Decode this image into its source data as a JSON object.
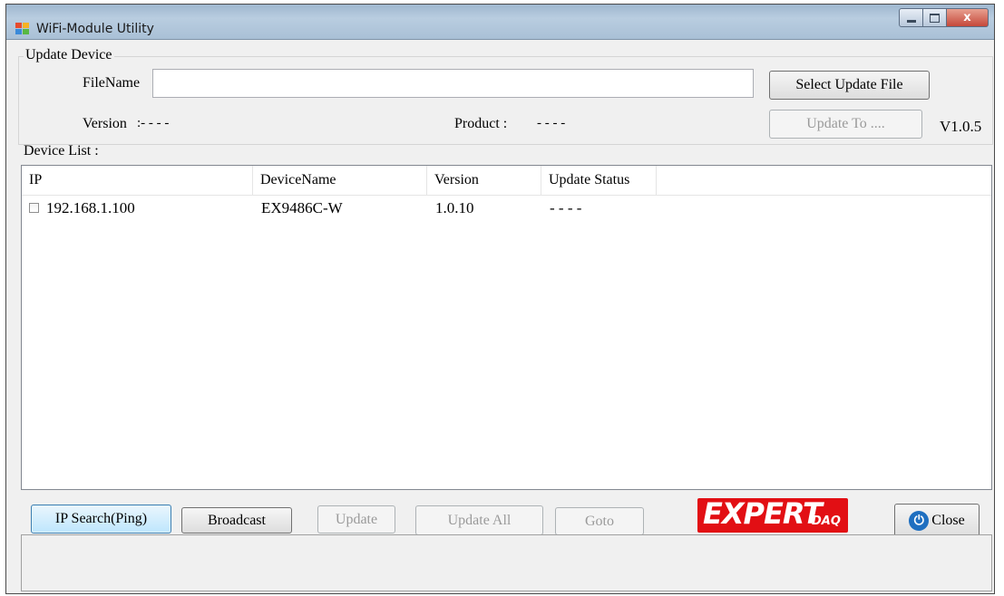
{
  "window": {
    "title": "WiFi-Module Utility",
    "close_glyph": "x"
  },
  "update_device": {
    "group_label": "Update Device",
    "filename_label": "FileName",
    "filename_value": "",
    "select_file_button": "Select Update File",
    "version_label": "Version",
    "version_value": ":- - - -",
    "product_label": "Product :",
    "product_value": "- - - -",
    "update_to_button": "Update To ....",
    "app_version": "V1.0.5"
  },
  "device_list": {
    "label": "Device List :",
    "columns": [
      "IP",
      "DeviceName",
      "Version",
      "Update Status"
    ],
    "rows": [
      {
        "ip": "192.168.1.100",
        "device_name": "EX9486C-W",
        "version": "1.0.10",
        "update_status": "- - - -",
        "checked": false
      }
    ]
  },
  "buttons": {
    "ip_search": "IP Search(Ping)",
    "broadcast": "Broadcast",
    "update": "Update",
    "update_all": "Update All",
    "goto": "Goto",
    "close": "Close"
  },
  "logo": {
    "main": "EXPERT",
    "sub": "DAQ"
  },
  "status_bar": {
    "text": ""
  },
  "colors": {
    "logo_red": "#e20f14",
    "titlebar": "#b9cde0",
    "close_icon_blue": "#1f6fc0"
  }
}
